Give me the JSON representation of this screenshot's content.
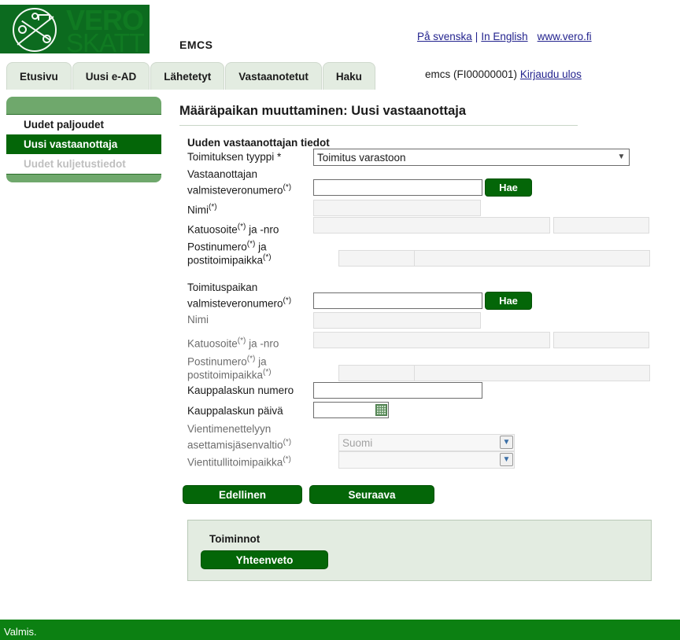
{
  "header": {
    "logo_line1": "VERO",
    "logo_line2": "SKATT",
    "app_name": "EMCS",
    "lang_links": [
      {
        "label": "På svenska",
        "name": "link-swedish"
      },
      {
        "label": "In English",
        "name": "link-english"
      },
      {
        "label": "www.vero.fi",
        "name": "link-vero-fi"
      }
    ],
    "separator": "|",
    "user_text": "emcs (FI00000001)",
    "logout_label": "Kirjaudu ulos"
  },
  "tabs": [
    {
      "label": "Etusivu",
      "name": "tab-etusivu"
    },
    {
      "label": "Uusi e-AD",
      "name": "tab-uusi-e-ad"
    },
    {
      "label": "Lähetetyt",
      "name": "tab-lahetetyt"
    },
    {
      "label": "Vastaanotetut",
      "name": "tab-vastaanotetut"
    },
    {
      "label": "Haku",
      "name": "tab-haku"
    }
  ],
  "sidebar": {
    "items": [
      {
        "label": "Uudet paljoudet",
        "state": "normal"
      },
      {
        "label": "Uusi vastaanottaja",
        "state": "active"
      },
      {
        "label": "Uudet kuljetustiedot",
        "state": "disabled"
      }
    ]
  },
  "main": {
    "page_title": "Määräpaikan muuttaminen: Uusi vastaanottaja",
    "section_title": "Uuden vastaanottajan tiedot",
    "labels": {
      "delivery_type": "Toimituksen tyyppi *",
      "consignee_excise_l1": "Vastaanottajan",
      "consignee_excise_l2": "valmisteveronumero",
      "name1": "Nimi",
      "street1": "Katuosoite",
      "street1_suffix": "ja -nro",
      "postcode1_l1": "Postinumero",
      "postcode1_l1_suffix": "ja",
      "postcode1_l2": "postitoimipaikka",
      "place_excise_l1": "Toimituspaikan",
      "place_excise_l2": "valmisteveronumero",
      "name2": "Nimi",
      "street2": "Katuosoite",
      "street2_suffix": "ja -nro",
      "postcode2_l1": "Postinumero",
      "postcode2_l1_suffix": "ja",
      "postcode2_l2": "postitoimipaikka",
      "invoice_number": "Kauppalaskun numero",
      "invoice_date": "Kauppalaskun päivä",
      "export_state_l1": "Vientimenettelyyn",
      "export_state_l2": "asettamisjäsenvaltio",
      "export_office": "Vientitullitoimipaikka",
      "optional_marker": "(*)"
    },
    "values": {
      "delivery_type": "Toimitus varastoon",
      "consignee_excise": "",
      "name1": "",
      "street1": "",
      "postcode1": "",
      "city1": "",
      "place_excise": "",
      "name2": "",
      "street2": "",
      "postcode2": "",
      "city2": "",
      "invoice_number": "",
      "invoice_date": "",
      "export_state": "Suomi",
      "export_office": ""
    },
    "buttons": {
      "search1": "Hae",
      "search2": "Hae",
      "previous": "Edellinen",
      "next": "Seuraava"
    }
  },
  "actions": {
    "title": "Toiminnot",
    "summary_label": "Yhteenveto"
  },
  "status": {
    "text": "Valmis."
  },
  "colors": {
    "brand_green": "#046608",
    "light_green": "#6fa86c",
    "tab_bg": "#e3ece1",
    "status_green": "#0c8012",
    "link_blue": "#23238e"
  }
}
